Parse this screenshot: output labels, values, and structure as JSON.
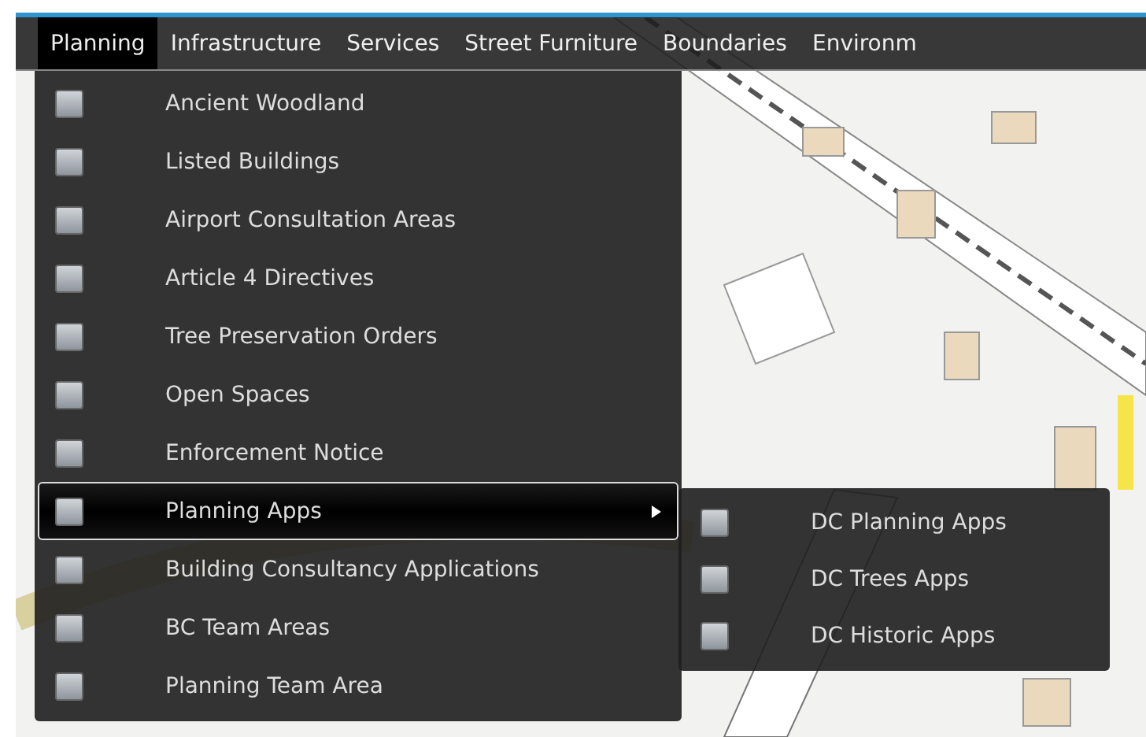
{
  "menubar": [
    {
      "label": "Planning",
      "selected": true
    },
    {
      "label": "Infrastructure",
      "selected": false
    },
    {
      "label": "Services",
      "selected": false
    },
    {
      "label": "Street Furniture",
      "selected": false
    },
    {
      "label": "Boundaries",
      "selected": false
    },
    {
      "label": "Environm",
      "selected": false
    }
  ],
  "menu": [
    {
      "label": "Ancient Woodland",
      "checked": false,
      "kind": "layer",
      "highlighted": false
    },
    {
      "label": "Listed Buildings",
      "checked": false,
      "kind": "layer",
      "highlighted": false
    },
    {
      "label": "Airport Consultation Areas",
      "checked": false,
      "kind": "layer",
      "highlighted": false
    },
    {
      "label": "Article 4 Directives",
      "checked": false,
      "kind": "layer",
      "highlighted": false
    },
    {
      "label": "Tree Preservation Orders",
      "checked": false,
      "kind": "layer",
      "highlighted": false
    },
    {
      "label": "Open Spaces",
      "checked": false,
      "kind": "layer",
      "highlighted": false
    },
    {
      "label": "Enforcement Notice",
      "checked": false,
      "kind": "layer",
      "highlighted": false
    },
    {
      "label": "Planning Apps",
      "checked": false,
      "kind": "submenu",
      "highlighted": true,
      "expanded": true
    },
    {
      "label": "Building Consultancy Applications",
      "checked": false,
      "kind": "layer",
      "highlighted": false
    },
    {
      "label": "BC Team Areas",
      "checked": false,
      "kind": "layer",
      "highlighted": false
    },
    {
      "label": "Planning Team Area",
      "checked": false,
      "kind": "layer",
      "highlighted": false
    }
  ],
  "submenu": [
    {
      "label": "DC Planning Apps",
      "checked": false
    },
    {
      "label": "DC Trees Apps",
      "checked": false
    },
    {
      "label": "DC Historic Apps",
      "checked": false
    }
  ]
}
